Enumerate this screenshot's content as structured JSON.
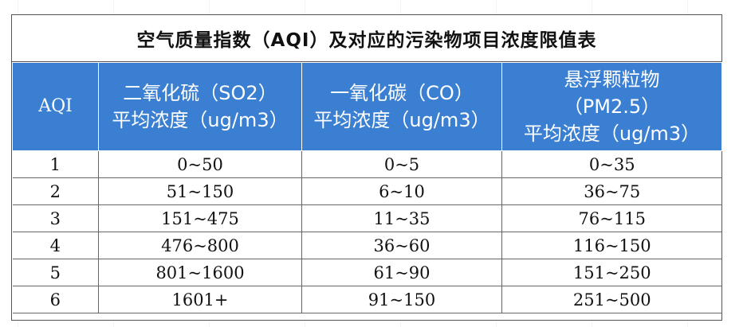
{
  "title": "空气质量指数（AQI）及对应的污染物项目浓度限值表",
  "headers": {
    "aqi": "AQI",
    "so2": [
      "二氧化硫（SO2）",
      "平均浓度（ug/m3）"
    ],
    "co": [
      "一氧化碳（CO）",
      "平均浓度（ug/m3）"
    ],
    "pm25": [
      "悬浮颗粒物",
      "（PM2.5）",
      "平均浓度（ug/m3）"
    ]
  },
  "rows": [
    [
      "1",
      "0~50",
      "0~5",
      "0~35"
    ],
    [
      "2",
      "51~150",
      "6~10",
      "36~75"
    ],
    [
      "3",
      "151~475",
      "11~35",
      "76~115"
    ],
    [
      "4",
      "476~800",
      "36~60",
      "116~150"
    ],
    [
      "5",
      "801~1600",
      "61~90",
      "151~250"
    ],
    [
      "6",
      "1601+",
      "91~150",
      "251~500"
    ]
  ],
  "colors": {
    "header_bg": "#3a7fd1",
    "header_text": "#ffffff",
    "border": "#555555"
  }
}
